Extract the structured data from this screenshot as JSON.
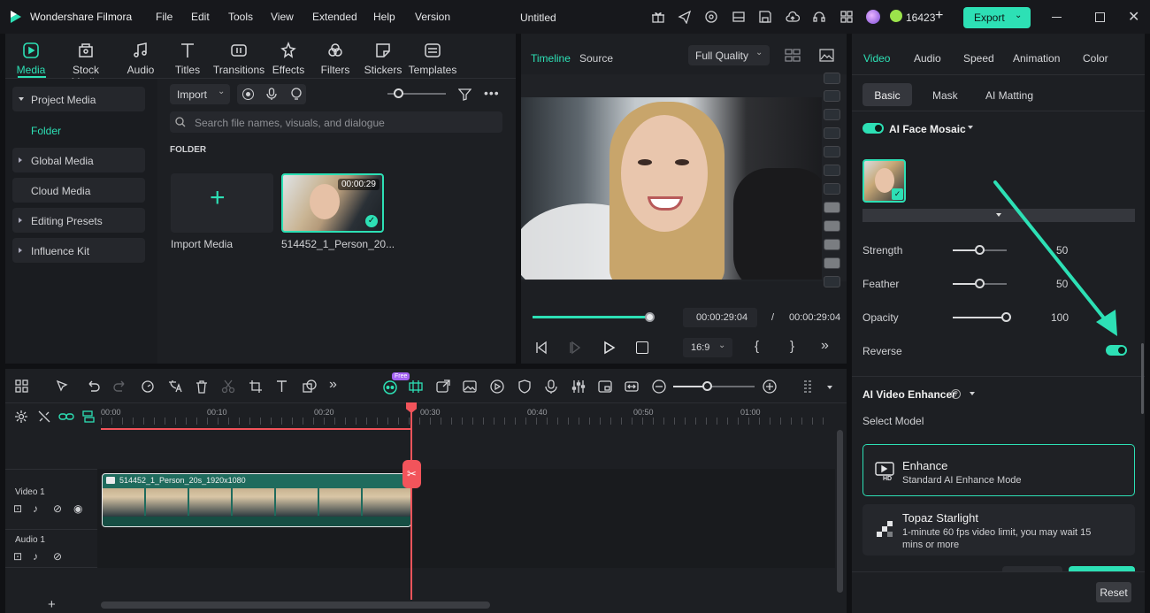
{
  "app": {
    "name": "Wondershare Filmora",
    "document_title": "Untitled",
    "credits": "16423",
    "export_label": "Export"
  },
  "menu": [
    "File",
    "Edit",
    "Tools",
    "View",
    "Extended",
    "Help",
    "Version"
  ],
  "media_tabs": [
    {
      "label": "Media",
      "icon": "media-icon",
      "active": true
    },
    {
      "label": "Stock Media",
      "icon": "stock-media-icon"
    },
    {
      "label": "Audio",
      "icon": "audio-note-icon"
    },
    {
      "label": "Titles",
      "icon": "titles-icon"
    },
    {
      "label": "Transitions",
      "icon": "transitions-icon"
    },
    {
      "label": "Effects",
      "icon": "effects-icon"
    },
    {
      "label": "Filters",
      "icon": "filters-icon"
    },
    {
      "label": "Stickers",
      "icon": "stickers-icon"
    },
    {
      "label": "Templates",
      "icon": "templates-icon"
    }
  ],
  "media_nav": {
    "project_media": "Project Media",
    "folder": "Folder",
    "global_media": "Global Media",
    "cloud_media": "Cloud Media",
    "editing_presets": "Editing Presets",
    "influence_kit": "Influence Kit"
  },
  "media_browser": {
    "import_label": "Import",
    "search_placeholder": "Search file names, visuals, and dialogue",
    "section_label": "FOLDER",
    "import_media_label": "Import Media",
    "clip_name": "514452_1_Person_20...",
    "clip_duration": "00:00:29"
  },
  "preview": {
    "tab_timeline": "Timeline",
    "tab_source": "Source",
    "quality": "Full Quality",
    "current_time": "00:00:29:04",
    "separator": "/",
    "total_time": "00:00:29:04",
    "aspect": "16:9",
    "progress": 1.0
  },
  "properties": {
    "tabs": [
      "Video",
      "Audio",
      "Speed",
      "Animation",
      "Color"
    ],
    "subtabs": [
      "Basic",
      "Mask",
      "AI Matting"
    ],
    "ai_face_mosaic": "AI Face Mosaic",
    "sliders": [
      {
        "label": "Strength",
        "value": "50",
        "level": 0.5
      },
      {
        "label": "Feather",
        "value": "50",
        "level": 0.5
      },
      {
        "label": "Opacity",
        "value": "100",
        "level": 1.0
      }
    ],
    "reverse_label": "Reverse",
    "reverse_on": true,
    "ai_video_enhancer": "AI Video Enhancer",
    "select_model": "Select Model",
    "models": [
      {
        "name": "Enhance",
        "desc": "Standard AI Enhance Mode",
        "selected": true
      },
      {
        "name": "Topaz Starlight",
        "desc": "1-minute 60 fps video limit, you may wait 15 mins or more"
      }
    ],
    "reset_label": "Reset"
  },
  "timeline": {
    "free_badge": "Free",
    "ruler": [
      "00:00",
      "00:10",
      "00:20",
      "00:30",
      "00:40",
      "00:50",
      "01:00"
    ],
    "tracks": [
      {
        "label": "Video 1"
      },
      {
        "label": "Audio 1"
      }
    ],
    "clip_label": "514452_1_Person_20s_1920x1080",
    "add_track": "+"
  },
  "colors": {
    "accent": "#2de0b5",
    "playhead": "#f2545b",
    "clip": "#1f6b5d"
  }
}
